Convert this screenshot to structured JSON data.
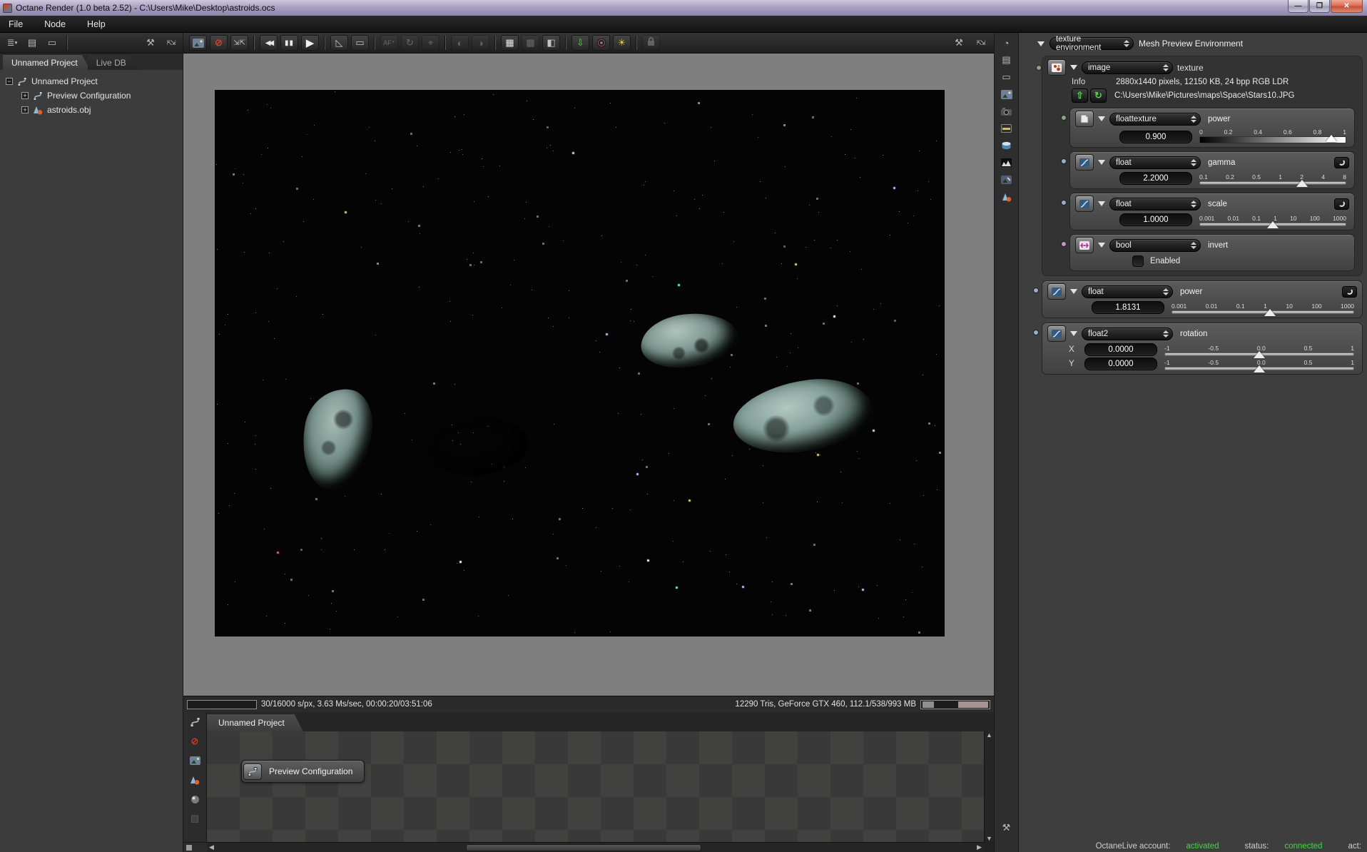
{
  "window": {
    "title": "Octane Render (1.0 beta 2.52) - C:\\Users\\Mike\\Desktop\\astroids.ocs",
    "minimize": "—",
    "restore": "❐",
    "close": "✕"
  },
  "menu": {
    "items": [
      "File",
      "Node",
      "Help"
    ]
  },
  "project_panel": {
    "tabs": [
      {
        "label": "Unnamed Project"
      },
      {
        "label": "Live DB"
      }
    ],
    "tree": [
      {
        "expander": "-",
        "icon": "nodegraph-icon",
        "label": "Unnamed Project"
      },
      {
        "expander": "+",
        "icon": "nodegraph-icon",
        "label": "Preview Configuration"
      },
      {
        "expander": "+",
        "icon": "mesh-icon",
        "label": "astroids.obj"
      }
    ],
    "toolbar_icons": [
      "tree-list-icon",
      "duplicate-icon",
      "link-nodes-icon",
      "wrench-icon",
      "expand-icon"
    ]
  },
  "viewport": {
    "toolbar_icons": [
      "picture-icon",
      "stop-render-icon",
      "restart-render-icon",
      "rewind-icon",
      "pause-icon",
      "play-icon",
      "ruler-icon",
      "region-icon",
      "autofocus-icon",
      "orbit-icon",
      "pick-focus-icon",
      "sphere-a-icon",
      "sphere-b-icon",
      "alpha-checker-icon",
      "checker-b-icon",
      "split-view-icon",
      "save-image-icon",
      "record-icon",
      "sun-light-icon",
      "lock-icon",
      "wrench-icon",
      "expand-icon"
    ],
    "status_left": "30/16000 s/px, 3.63 Ms/sec, 00:00:20/03:51:06",
    "status_right": "12290 Tris, GeForce GTX 460, 112.1/538/993 MB"
  },
  "right_strip_icons": [
    "render-target-icon",
    "duplicate-icon",
    "link-nodes-icon",
    "image-icon",
    "camera-icon",
    "film-settings-icon",
    "environment-icon",
    "histogram-icon",
    "imager-icon",
    "mesh-icon",
    "wrench-icon"
  ],
  "inspector": {
    "root": {
      "type": "texture environment",
      "label": "Mesh Preview Environment"
    },
    "image_node": {
      "type": "image",
      "label": "texture",
      "info_label": "Info",
      "info": "2880x1440 pixels, 12150 KB, 24 bpp RGB LDR",
      "path": "C:\\Users\\Mike\\Pictures\\maps\\Space\\Stars10.JPG",
      "reload_glyph": "↻",
      "load_glyph": "⇧"
    },
    "params": [
      {
        "type": "floattexture",
        "label": "power",
        "value": "0.900",
        "ticks": [
          "0",
          "0.2",
          "0.4",
          "0.6",
          "0.8",
          "1"
        ]
      },
      {
        "type": "float",
        "label": "gamma",
        "value": "2.2000",
        "ticks": [
          "0.1",
          "0.2",
          "0.5",
          "1",
          "2",
          "4",
          "8"
        ]
      },
      {
        "type": "float",
        "label": "scale",
        "value": "1.0000",
        "ticks": [
          "0.001",
          "0.01",
          "0.1",
          "1",
          "10",
          "100",
          "1000"
        ]
      },
      {
        "type": "bool",
        "label": "invert",
        "checkbox_label": "Enabled"
      },
      {
        "type": "float",
        "label": "power",
        "value": "1.8131",
        "ticks": [
          "0.001",
          "0.01",
          "0.1",
          "1",
          "10",
          "100",
          "1000"
        ]
      },
      {
        "type": "float2",
        "label": "rotation",
        "x_label": "X",
        "x_value": "0.0000",
        "y_label": "Y",
        "y_value": "0.0000",
        "ticks": [
          "-1",
          "-0.5",
          "0.0",
          "0.5",
          "1"
        ]
      }
    ]
  },
  "nodegraph": {
    "tab": "Unnamed Project",
    "node_label": "Preview Configuration",
    "strip_icons": [
      "nodegraph-tool-icon",
      "stop-icon",
      "image-preview-icon",
      "mesh-preview-icon",
      "material-preview-icon",
      "texture-preview-icon"
    ]
  },
  "livebar": {
    "account_label": "OctaneLive account:",
    "account_value": "activated",
    "status_label": "status:",
    "status_value": "connected",
    "act_label": "act:",
    "green": "#36e036"
  },
  "colors": {
    "accent_green": "#36e036",
    "pin_green": "#87a77f",
    "pin_blue": "#9cadc8",
    "pin_pink": "#c697c0",
    "titlebar": "#a9a2c2"
  }
}
